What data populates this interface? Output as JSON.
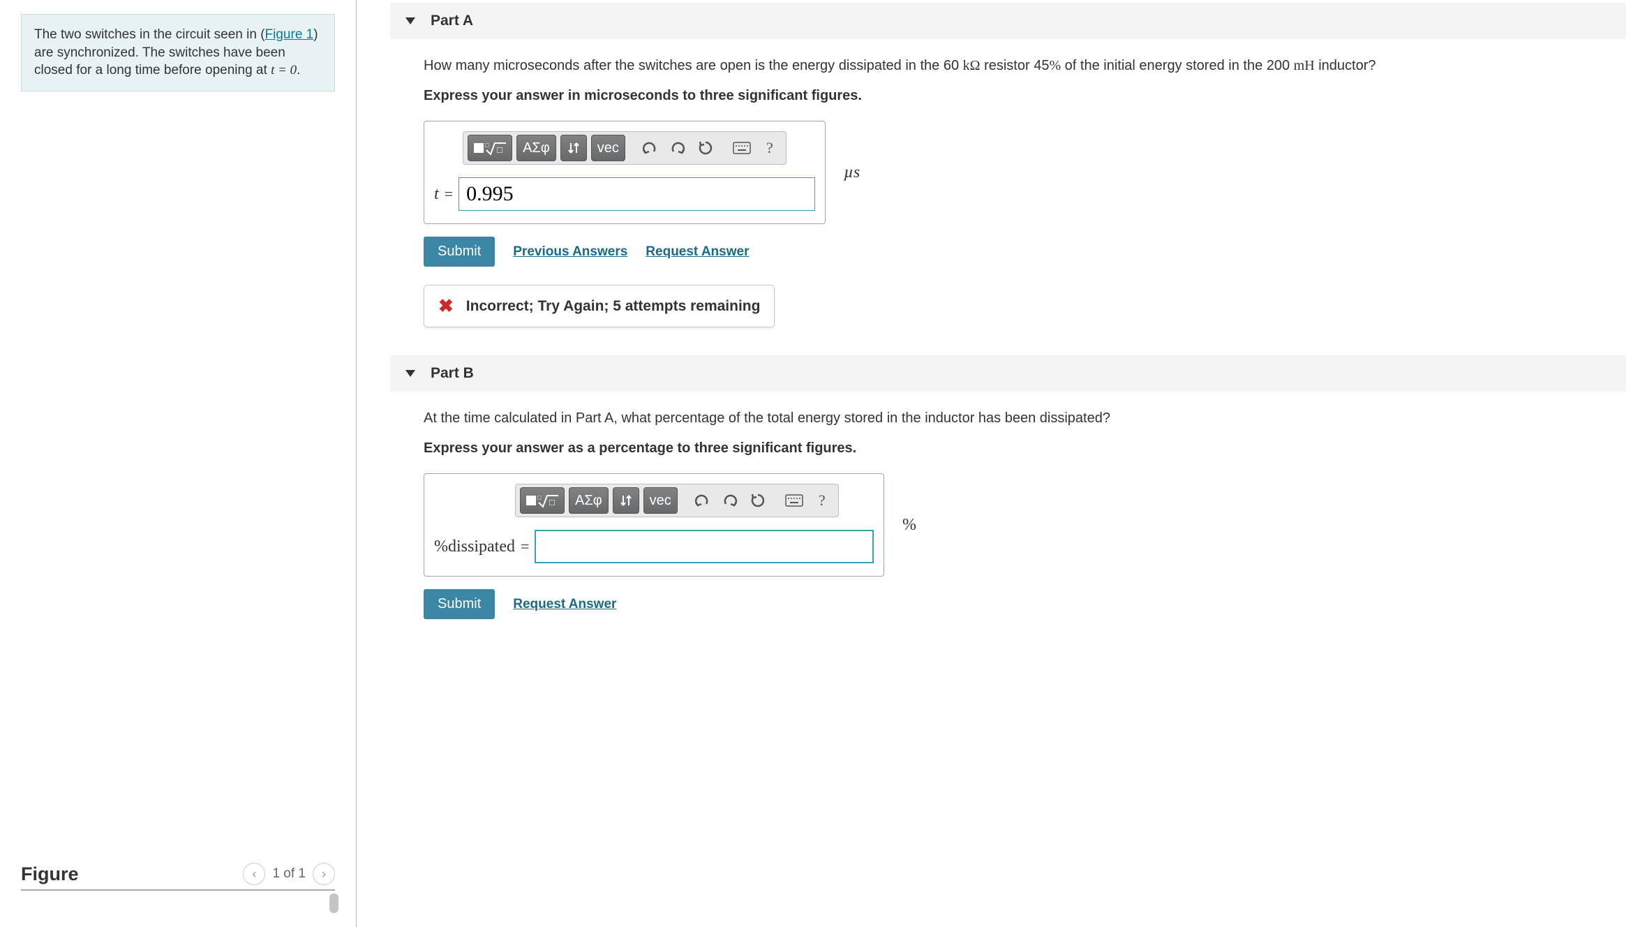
{
  "problem": {
    "prefix": "The two switches in the circuit seen in (",
    "figure_link": "Figure 1",
    "mid": ") are synchronized. The switches have been closed for a long time before opening at ",
    "time_expr": "t = 0",
    "suffix": "."
  },
  "figure": {
    "title": "Figure",
    "pager": "1 of 1"
  },
  "partA": {
    "header": "Part A",
    "question_pre": "How many microseconds after the switches are open is the energy dissipated in the 60 ",
    "kohm": "kΩ",
    "question_mid": " resistor 45",
    "pct": "%",
    "question_mid2": " of the initial energy stored in the 200 ",
    "mh": "mH",
    "question_post": " inductor?",
    "instruction": "Express your answer in microseconds to three significant figures.",
    "label": "t",
    "value": "0.995",
    "unit": "µs",
    "submit": "Submit",
    "prev_answers": "Previous Answers",
    "request_answer": "Request Answer",
    "feedback": "Incorrect; Try Again; 5 attempts remaining"
  },
  "partB": {
    "header": "Part B",
    "question": "At the time calculated in Part A, what percentage of the total energy stored in the inductor has been dissipated?",
    "instruction": "Express your answer as a percentage to three significant figures.",
    "label": "%dissipated",
    "value": "",
    "unit": "%",
    "submit": "Submit",
    "request_answer": "Request Answer"
  },
  "toolbar": {
    "greek": "ΑΣφ",
    "vec": "vec",
    "help": "?"
  }
}
